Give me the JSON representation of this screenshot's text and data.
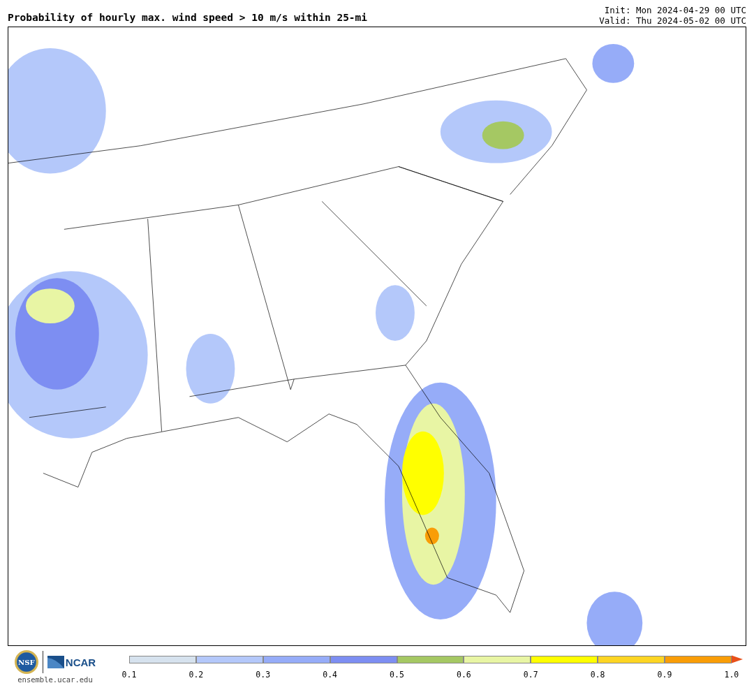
{
  "title": "Probability of hourly max. wind speed > 10 m/s within 25-mi",
  "init": "Init: Mon 2024-04-29 00 UTC",
  "valid": "Valid: Thu 2024-05-02 00 UTC",
  "logos": {
    "nsf": "NSF",
    "ncar": "NCAR",
    "url": "ensemble.ucar.edu"
  },
  "colorbar": {
    "segments": [
      {
        "color": "#d6e2ee"
      },
      {
        "color": "#b4c8fa"
      },
      {
        "color": "#96acf8"
      },
      {
        "color": "#7d8ef2"
      },
      {
        "color": "#a5c863"
      },
      {
        "color": "#e8f5a4"
      },
      {
        "color": "#ffff00"
      },
      {
        "color": "#fdd523"
      },
      {
        "color": "#f99d07"
      }
    ],
    "extension": {
      "color": "#e8501a"
    },
    "ticks": [
      "0.1",
      "0.2",
      "0.3",
      "0.4",
      "0.5",
      "0.6",
      "0.7",
      "0.8",
      "0.9",
      "1.0"
    ]
  }
}
